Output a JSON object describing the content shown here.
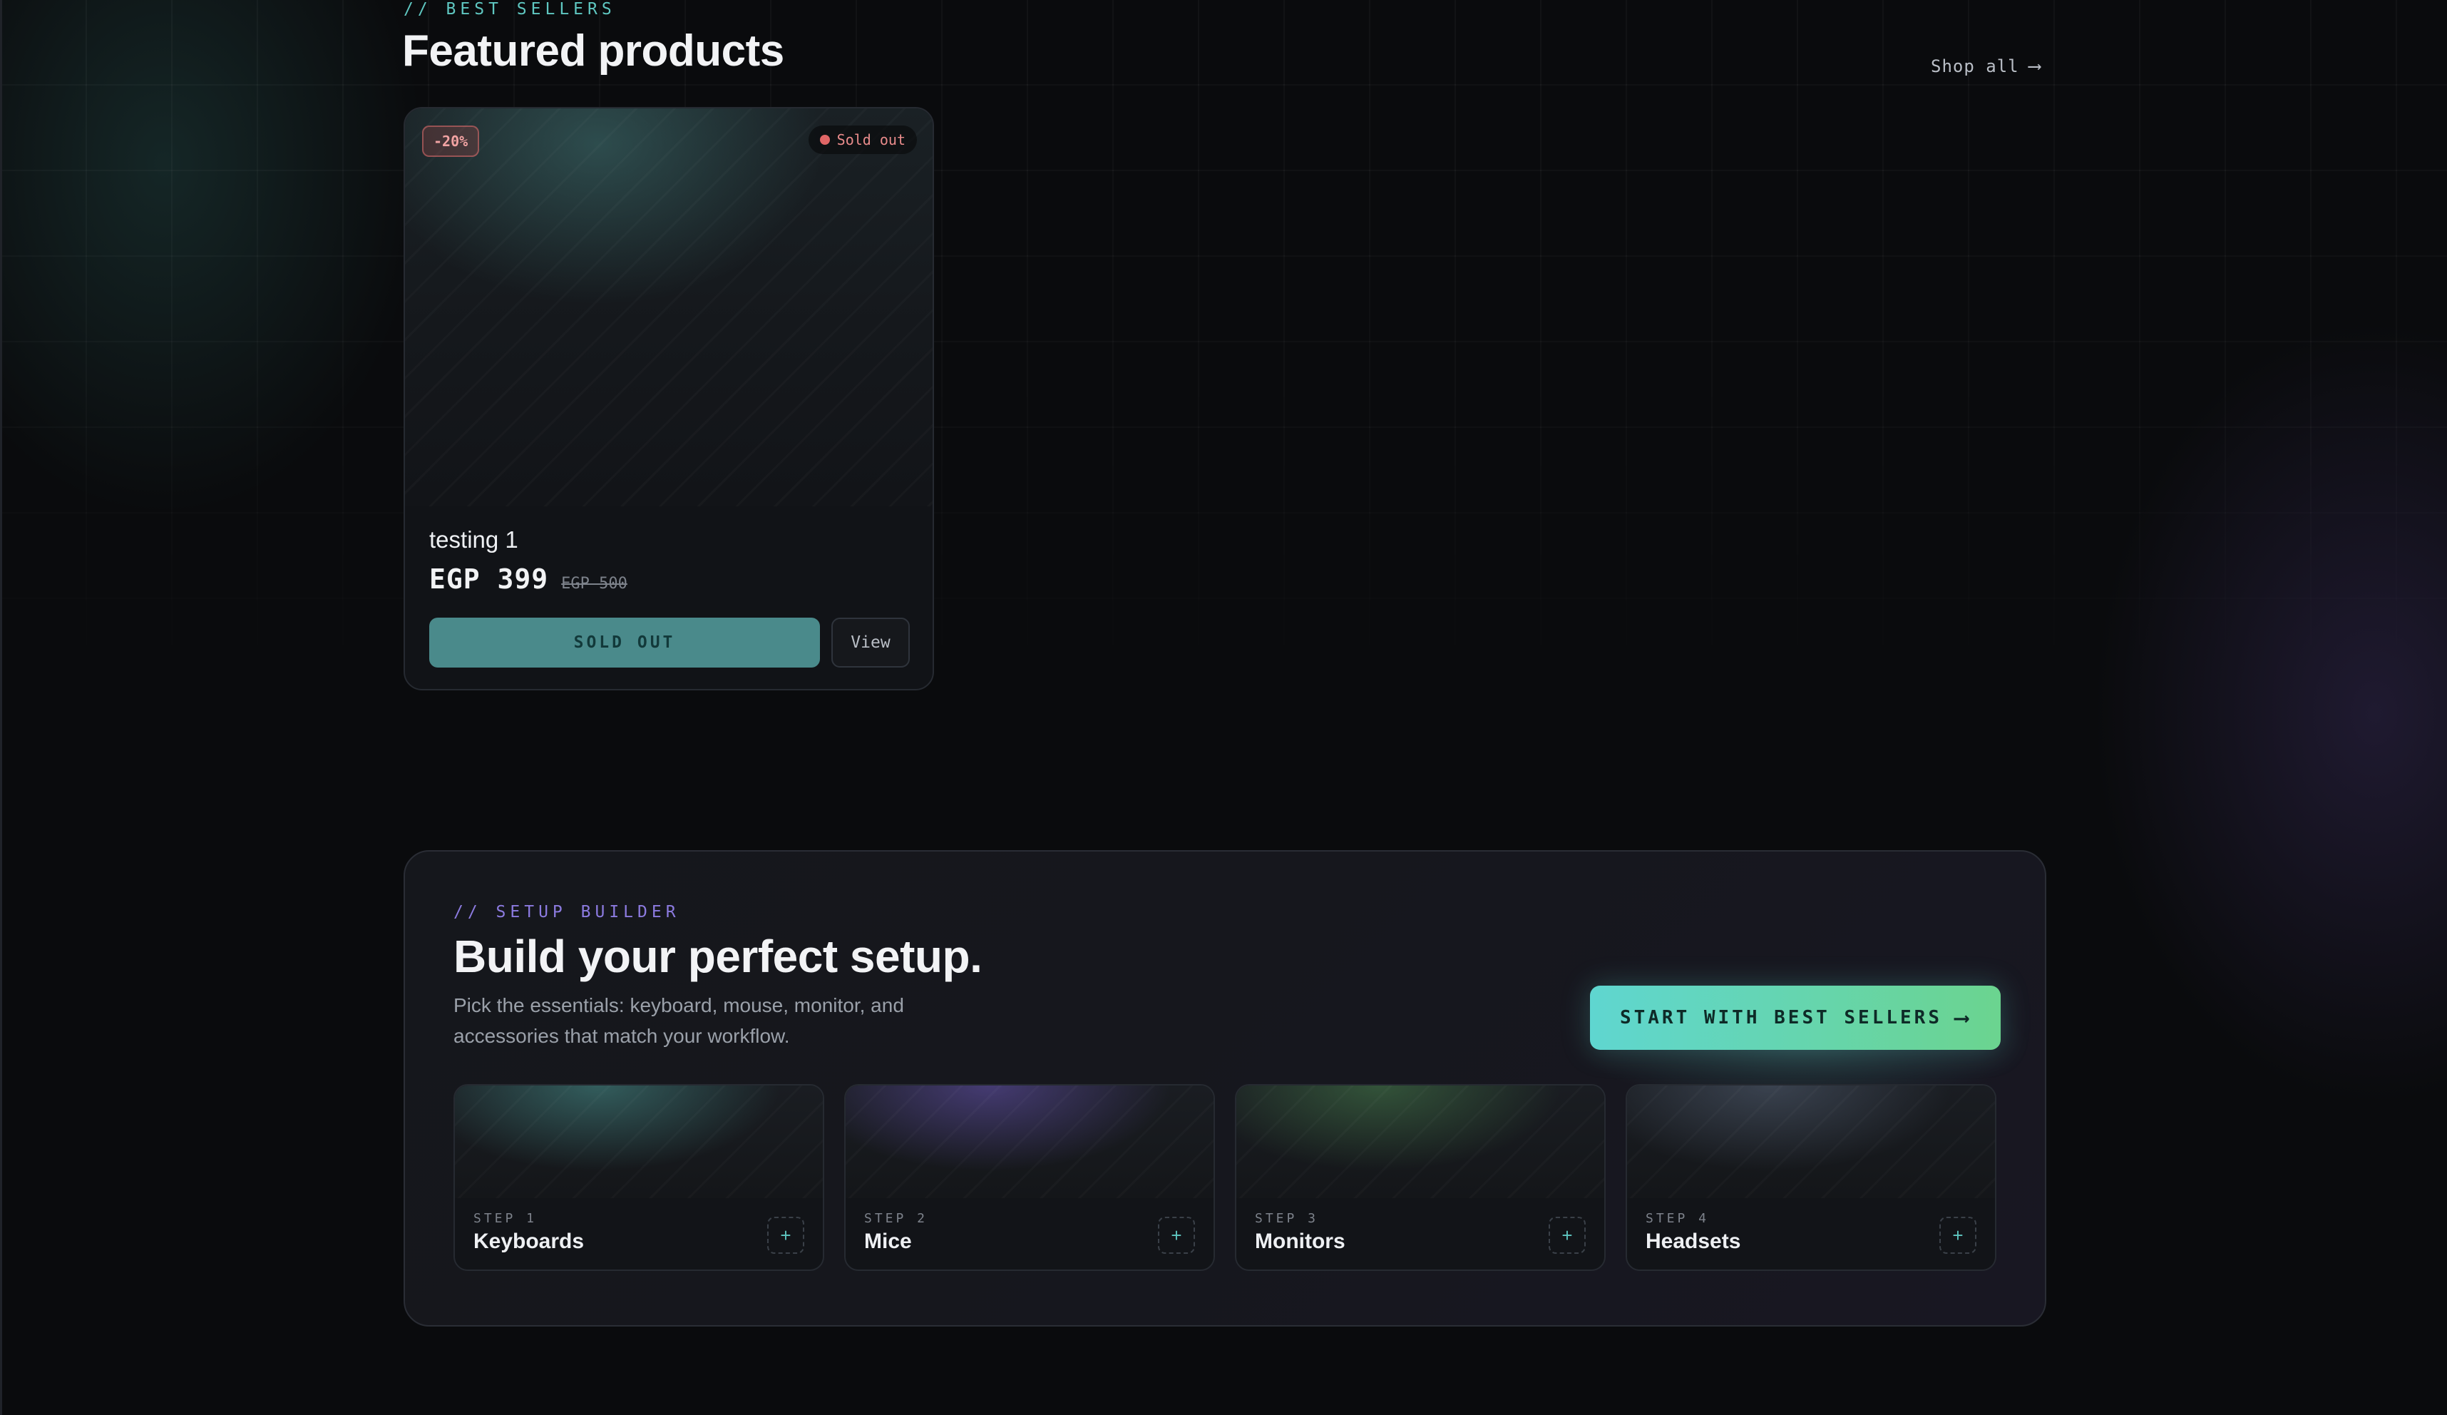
{
  "featured": {
    "eyebrow": "// BEST SELLERS",
    "title": "Featured products",
    "shop_all_label": "Shop all",
    "shop_all_arrow": "⟶"
  },
  "product": {
    "discount": "-20%",
    "status_badge": "Sold out",
    "name": "testing 1",
    "price": "EGP 399",
    "old_price": "EGP 500",
    "primary_button": "SOLD OUT",
    "secondary_button": "View"
  },
  "builder": {
    "eyebrow": "// SETUP BUILDER",
    "title": "Build your perfect setup.",
    "description": "Pick the essentials: keyboard, mouse, monitor, and accessories that match your workflow.",
    "cta_label": "START WITH BEST SELLERS",
    "cta_arrow": "⟶",
    "steps": [
      {
        "label": "STEP 1",
        "name": "Keyboards",
        "accent": "#3f7d7a"
      },
      {
        "label": "STEP 2",
        "name": "Mice",
        "accent": "#5a4a9a"
      },
      {
        "label": "STEP 3",
        "name": "Monitors",
        "accent": "#3f6e45"
      },
      {
        "label": "STEP 4",
        "name": "Headsets",
        "accent": "#4a5566"
      }
    ],
    "step_add_icon": "+"
  },
  "colors": {
    "background": "#0a0b0d",
    "accent_teal": "#5fc7c1",
    "accent_purple": "#8c7be0",
    "sold_out_red": "#e06666"
  }
}
